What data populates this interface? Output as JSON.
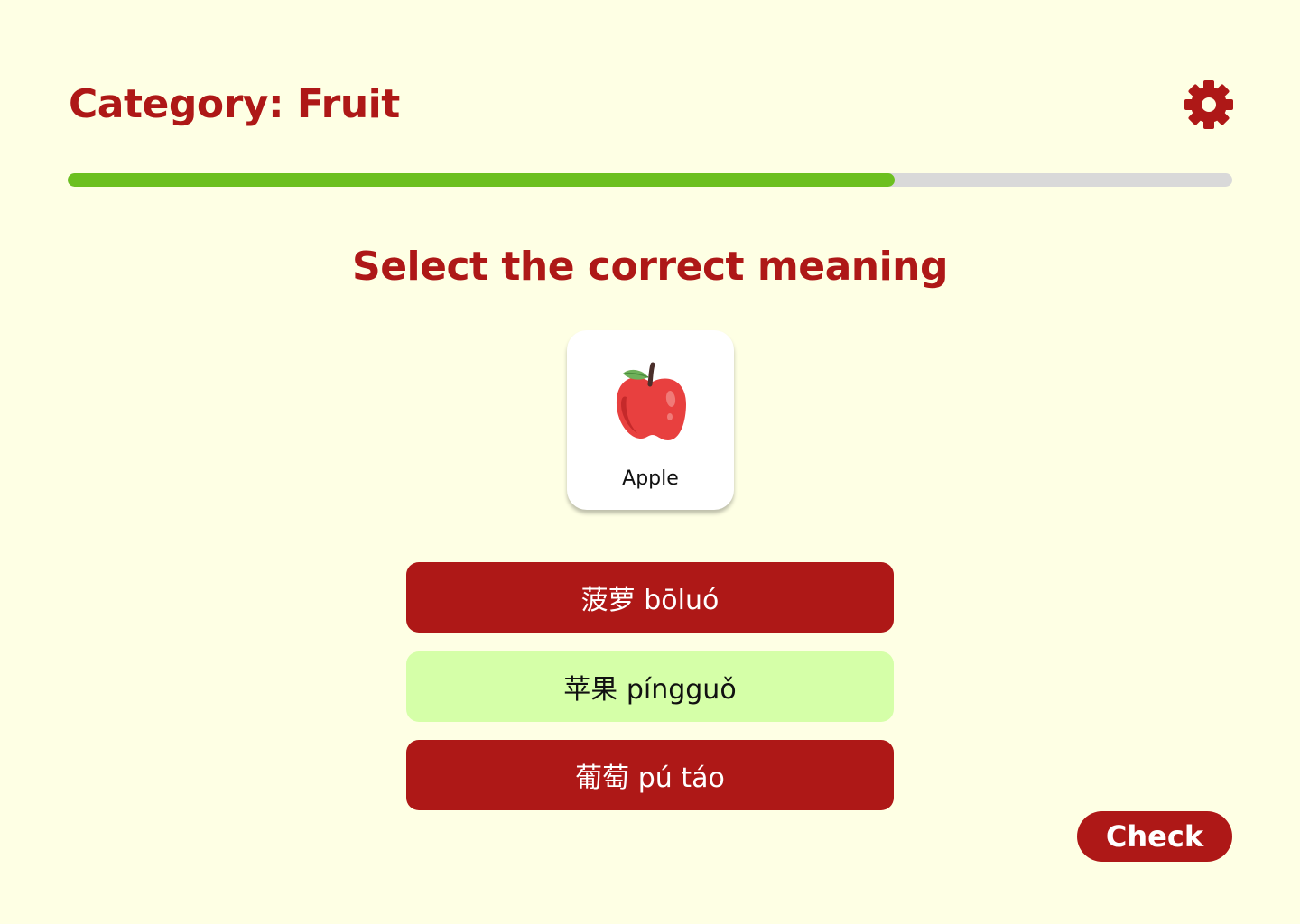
{
  "header": {
    "title": "Category: Fruit",
    "settings_icon": "gear-icon"
  },
  "progress": {
    "value_fraction": 0.71
  },
  "quiz": {
    "prompt": "Select the correct meaning",
    "card": {
      "image_icon": "apple-icon",
      "label": "Apple"
    },
    "options": [
      {
        "text": "菠萝 bōluó",
        "selected": false
      },
      {
        "text": "苹果 píngguǒ",
        "selected": true
      },
      {
        "text": "葡萄 pú táo",
        "selected": false
      }
    ],
    "check_label": "Check"
  },
  "colors": {
    "background": "#FEFFE4",
    "brand_red": "#AE1817",
    "progress_green": "#6CC01F",
    "progress_track": "#D9D9D9",
    "selected_option": "#D5FFA8",
    "card_background": "#FFFFFF"
  }
}
